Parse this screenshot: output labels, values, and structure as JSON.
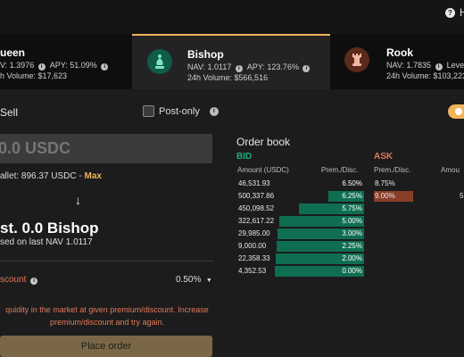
{
  "help": {
    "label": "H"
  },
  "tokens": [
    {
      "name": "ueen",
      "line1_nav": "V: 1.3976",
      "line1_apy": "APY: 51.09%",
      "line2": "h Volume: $17,623"
    },
    {
      "name": "Bishop",
      "line1_nav": "NAV: 1.0117",
      "line1_apy": "APY: 123.76%",
      "line2": "24h Volume: $566,516"
    },
    {
      "name": "Rook",
      "line1_nav": "NAV: 1.7835",
      "line1_apy": "Lever",
      "line2": "24h Volume: $103,223"
    }
  ],
  "trade": {
    "side_label": "Sell",
    "post_only_label": "Post-only",
    "amount_value": "0.0 USDC",
    "wallet_label": "allet: 896.37 USDC -",
    "max_label": "Max",
    "arrow": "↓",
    "estimate": "st. 0.0 Bishop",
    "based_on": "sed on last NAV 1.0117",
    "discount_label": "scount",
    "discount_value": "0.50%",
    "warning": "quidity in the market at given premium/discount. Increase premium/discount and try again.",
    "place_label": "Place order"
  },
  "orderbook": {
    "title": "Order book",
    "bid_label": "BID",
    "ask_label": "ASK",
    "bid_amount_header": "Amount (USDC)",
    "bid_prem_header": "Prem./Disc.",
    "ask_prem_header": "Prem./Disc.",
    "ask_amount_header": "Amou",
    "bids": [
      {
        "amount": "46,531.93",
        "prem": "6.50%",
        "depth": 0.0
      },
      {
        "amount": "500,337.86",
        "prem": "6.25%",
        "depth": 0.4
      },
      {
        "amount": "450,098.52",
        "prem": "5.75%",
        "depth": 0.73
      },
      {
        "amount": "322,617.22",
        "prem": "5.00%",
        "depth": 0.95
      },
      {
        "amount": "29,985.00",
        "prem": "3.00%",
        "depth": 0.97
      },
      {
        "amount": "9,000.00",
        "prem": "2.25%",
        "depth": 0.98
      },
      {
        "amount": "22,358.33",
        "prem": "2.00%",
        "depth": 0.99
      },
      {
        "amount": "4,352.53",
        "prem": "0.00%",
        "depth": 1.0
      }
    ],
    "asks": [
      {
        "prem": "8.75%",
        "amount": "",
        "depth": 0.0
      },
      {
        "prem": "9.00%",
        "amount": "5",
        "depth": 1.0
      }
    ]
  },
  "colors": {
    "accent": "#f0b35a",
    "bid": "#1fae7a",
    "bid_bar": "#0f6e52",
    "ask": "#e07a5a",
    "ask_bar": "#8a3e2a"
  }
}
